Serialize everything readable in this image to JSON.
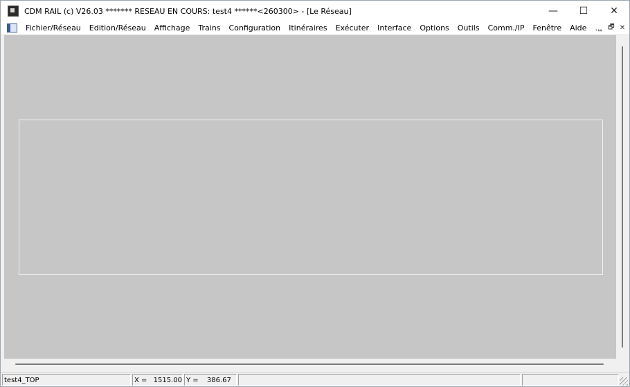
{
  "window": {
    "title": "CDM RAIL (c) V26.03     ******* RESEAU EN COURS: test4 ******<260300> - [Le Réseau]",
    "app_icon": "cdm-rail-icon",
    "caption_buttons": {
      "minimize": "—",
      "maximize": "☐",
      "close": "✕"
    }
  },
  "menubar": {
    "doc_icon": "mdi-document-icon",
    "items": [
      "Fichier/Réseau",
      "Edition/Réseau",
      "Affichage",
      "Trains",
      "Configuration",
      "Itinéraires",
      "Exécuter",
      "Interface",
      "Options",
      "Outils",
      "Comm./IP",
      "Fenêtre",
      "Aide",
      "..."
    ],
    "mdi_buttons": {
      "minimize": "_",
      "restore": "🗗",
      "close": "✕"
    }
  },
  "statusbar": {
    "network": "test4_TOP",
    "x_label": "X =",
    "x_value": "1515.00",
    "y_label": "Y =",
    "y_value": "386.67"
  },
  "colors": {
    "canvas_background": "#c6c6c6",
    "canvas_border": "#f2f2f2"
  }
}
